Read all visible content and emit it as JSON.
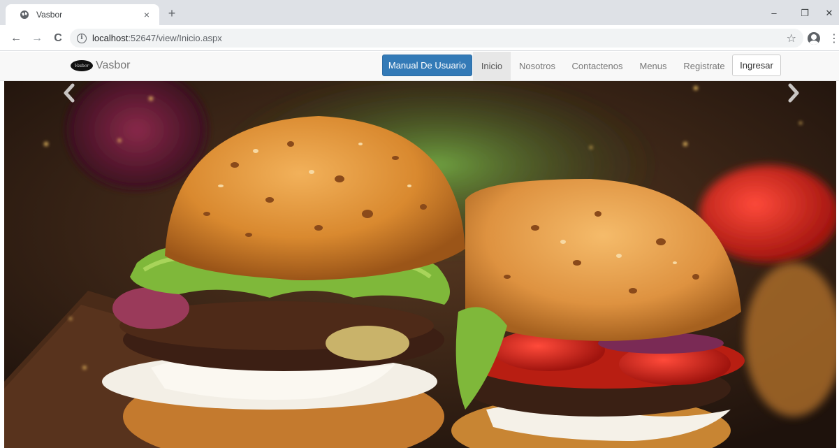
{
  "browser": {
    "tab_title": "Vasbor",
    "tab_close": "×",
    "new_tab": "+",
    "url_host": "localhost",
    "url_path": ":52647/view/Inicio.aspx",
    "icons": {
      "favicon": "globe-icon",
      "back": "back-arrow-icon",
      "forward": "forward-arrow-icon",
      "reload": "reload-icon",
      "info": "info-icon",
      "star": "star-icon",
      "account": "account-icon",
      "menu": "kebab-menu-icon",
      "minimize": "minimize-icon",
      "restore": "restore-icon",
      "close": "close-icon"
    },
    "glyphs": {
      "back": "←",
      "forward": "→",
      "reload": "C",
      "info": "i",
      "star": "☆",
      "menu": "⋮",
      "minimize": "–",
      "restore": "❐",
      "close": "✕"
    }
  },
  "navbar": {
    "brand_logo_text": "Vasbor",
    "brand_name": "Vasbor",
    "manual_button": "Manual De Usuario",
    "items": [
      {
        "label": "Inicio",
        "active": true
      },
      {
        "label": "Nosotros",
        "active": false
      },
      {
        "label": "Contactenos",
        "active": false
      },
      {
        "label": "Menus",
        "active": false
      },
      {
        "label": "Registrate",
        "active": false
      }
    ],
    "login_button": "Ingresar"
  },
  "carousel": {
    "image_alt": "burgers-hero-image",
    "controls": [
      "chevron-left-icon",
      "chevron-right-icon"
    ]
  },
  "colors": {
    "primary_button": "#337ab7",
    "navbar_bg": "#f8f8f8",
    "active_item_bg": "#e7e7e7"
  }
}
